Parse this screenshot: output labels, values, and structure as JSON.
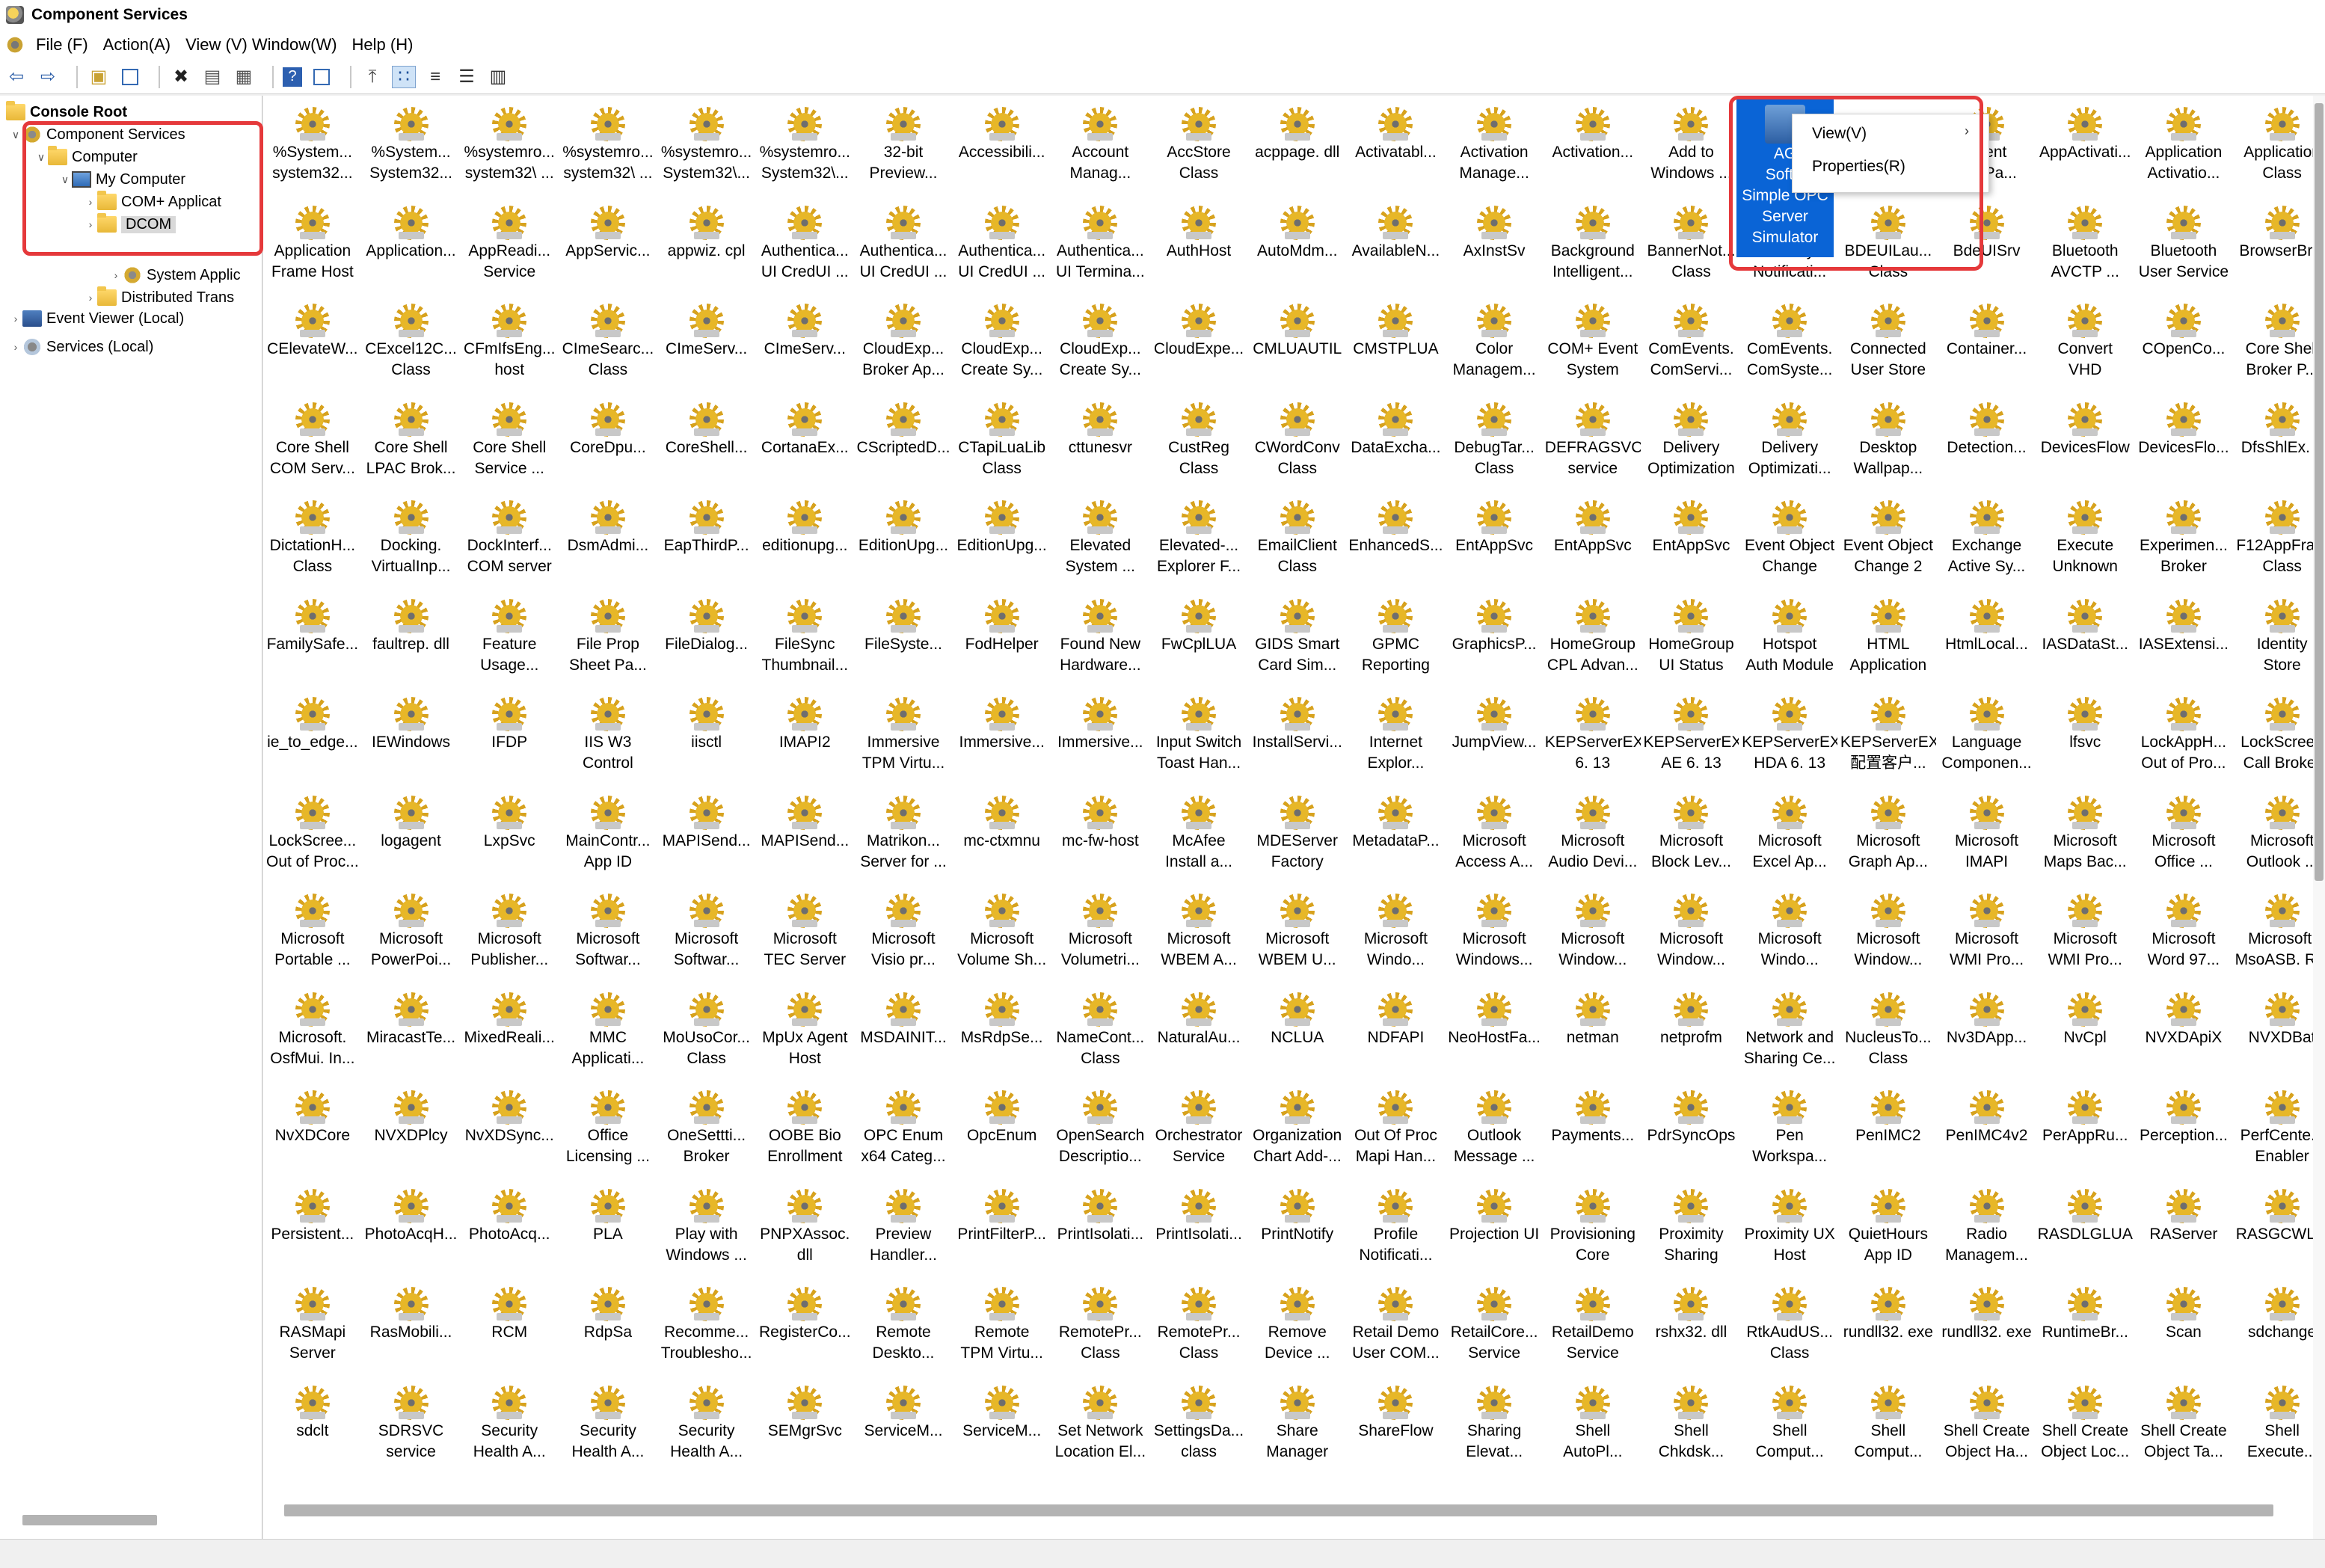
{
  "window": {
    "title": "Component Services"
  },
  "menu": [
    "File (F)",
    "Action(A)",
    "View (V)",
    "Window(W)",
    "Help (H)"
  ],
  "toolbar": [
    "back-icon",
    "forward-icon",
    "up-folder-icon",
    "show-hide-tree-icon",
    "delete-icon",
    "properties-icon",
    "refresh-icon",
    "help-icon",
    "console-icon",
    "export-icon",
    "large-icons-view-icon",
    "small-icons-view-icon",
    "list-view-icon",
    "detail-view-icon"
  ],
  "tree": {
    "console_root": "Console Root",
    "component_services": "Component Services",
    "computer": "Computer",
    "my_computer": "My Computer",
    "complus": "COM+ Applicat",
    "dcom": "DCOM",
    "system_apps": "System Applic",
    "dtc": "Distributed Trans",
    "event_viewer": "Event Viewer (Local)",
    "services": "Services (Local)"
  },
  "context_menu": {
    "view": "View(V)",
    "properties": "Properties(R)"
  },
  "selected_item": [
    "AG",
    "Softw",
    "Simple OPC",
    "Server",
    "Simulator"
  ],
  "items": [
    [
      "%System...",
      "system32..."
    ],
    [
      "%System...",
      "System32..."
    ],
    [
      "%systemro...",
      "system32\\ ..."
    ],
    [
      "%systemro...",
      "system32\\ ..."
    ],
    [
      "%systemro...",
      "System32\\..."
    ],
    [
      "%systemro...",
      "System32\\..."
    ],
    [
      "32-bit",
      "Preview..."
    ],
    [
      "Accessibili...",
      ""
    ],
    [
      "Account",
      "Manag..."
    ],
    [
      "AccStore",
      "Class"
    ],
    [
      "acppage. dll",
      ""
    ],
    [
      "Activatabl...",
      ""
    ],
    [
      "Activation",
      "Manage..."
    ],
    [
      "Activation...",
      ""
    ],
    [
      "Add to",
      "Windows ..."
    ],
    [
      "",
      ""
    ],
    [
      "",
      ""
    ],
    [
      "Client",
      "AppPa..."
    ],
    [
      "AppActivati...",
      ""
    ],
    [
      "Application",
      "Activatio..."
    ],
    [
      "Application",
      "Class"
    ],
    [
      "Application",
      "Frame Host"
    ],
    [
      "Application...",
      ""
    ],
    [
      "AppReadi...",
      "Service"
    ],
    [
      "AppServic...",
      ""
    ],
    [
      "appwiz. cpl",
      ""
    ],
    [
      "Authentica...",
      "UI CredUI ..."
    ],
    [
      "Authentica...",
      "UI CredUI ..."
    ],
    [
      "Authentica...",
      "UI CredUI ..."
    ],
    [
      "Authentica...",
      "UI Termina..."
    ],
    [
      "AuthHost",
      ""
    ],
    [
      "AutoMdm...",
      ""
    ],
    [
      "AvailableN...",
      ""
    ],
    [
      "AxInstSv",
      ""
    ],
    [
      "Background",
      "Intelligent..."
    ],
    [
      "BannerNot...",
      "Class"
    ],
    [
      "Battery",
      "Notificati..."
    ],
    [
      "BDEUILau...",
      "Class"
    ],
    [
      "BdeUISrv",
      ""
    ],
    [
      "Bluetooth",
      "AVCTP ..."
    ],
    [
      "Bluetooth",
      "User Service"
    ],
    [
      "BrowserBr...",
      ""
    ],
    [
      "CElevateW...",
      ""
    ],
    [
      "CExcel12C...",
      "Class"
    ],
    [
      "CFmIfsEng...",
      "host"
    ],
    [
      "CImeSearc...",
      "Class"
    ],
    [
      "CImeServ...",
      ""
    ],
    [
      "CImeServ...",
      ""
    ],
    [
      "CloudExp...",
      "Broker Ap..."
    ],
    [
      "CloudExp...",
      "Create Sy..."
    ],
    [
      "CloudExp...",
      "Create Sy..."
    ],
    [
      "CloudExpe...",
      ""
    ],
    [
      "CMLUAUTIL",
      ""
    ],
    [
      "CMSTPLUA",
      ""
    ],
    [
      "Color",
      "Managem..."
    ],
    [
      "COM+ Event",
      "System"
    ],
    [
      "ComEvents.",
      "ComServi..."
    ],
    [
      "ComEvents.",
      "ComSyste..."
    ],
    [
      "Connected",
      "User Store"
    ],
    [
      "Container...",
      ""
    ],
    [
      "Convert",
      "VHD"
    ],
    [
      "COpenCo...",
      ""
    ],
    [
      "Core Shell",
      "Broker P..."
    ],
    [
      "Core Shell",
      "COM Serv..."
    ],
    [
      "Core Shell",
      "LPAC Brok..."
    ],
    [
      "Core Shell",
      "Service ..."
    ],
    [
      "CoreDpu...",
      ""
    ],
    [
      "CoreShell...",
      ""
    ],
    [
      "CortanaEx...",
      ""
    ],
    [
      "CScriptedD...",
      ""
    ],
    [
      "CTapiLuaLib",
      "Class"
    ],
    [
      "cttunesvr",
      ""
    ],
    [
      "CustReg",
      "Class"
    ],
    [
      "CWordConv",
      "Class"
    ],
    [
      "DataExcha...",
      ""
    ],
    [
      "DebugTar...",
      "Class"
    ],
    [
      "DEFRAGSVC",
      "service"
    ],
    [
      "Delivery",
      "Optimization"
    ],
    [
      "Delivery",
      "Optimizati..."
    ],
    [
      "Desktop",
      "Wallpap..."
    ],
    [
      "Detection...",
      ""
    ],
    [
      "DevicesFlow",
      ""
    ],
    [
      "DevicesFlo...",
      ""
    ],
    [
      "DfsShlEx. d",
      ""
    ],
    [
      "DictationH...",
      "Class"
    ],
    [
      "Docking.",
      "VirtualInp..."
    ],
    [
      "DockInterf...",
      "COM server"
    ],
    [
      "DsmAdmi...",
      ""
    ],
    [
      "EapThirdP...",
      ""
    ],
    [
      "editionupg...",
      ""
    ],
    [
      "EditionUpg...",
      ""
    ],
    [
      "EditionUpg...",
      ""
    ],
    [
      "Elevated",
      "System ..."
    ],
    [
      "Elevated-...",
      "Explorer F..."
    ],
    [
      "EmailClient",
      "Class"
    ],
    [
      "EnhancedS...",
      ""
    ],
    [
      "EntAppSvc",
      ""
    ],
    [
      "EntAppSvc",
      ""
    ],
    [
      "EntAppSvc",
      ""
    ],
    [
      "Event Object",
      "Change"
    ],
    [
      "Event Object",
      "Change 2"
    ],
    [
      "Exchange",
      "Active Sy..."
    ],
    [
      "Execute",
      "Unknown"
    ],
    [
      "Experimen...",
      "Broker"
    ],
    [
      "F12AppFra...",
      "Class"
    ],
    [
      "FamilySafe...",
      ""
    ],
    [
      "faultrep. dll",
      ""
    ],
    [
      "Feature",
      "Usage..."
    ],
    [
      "File Prop",
      "Sheet Pa..."
    ],
    [
      "FileDialog...",
      ""
    ],
    [
      "FileSync",
      "Thumbnail..."
    ],
    [
      "FileSyste...",
      ""
    ],
    [
      "FodHelper",
      ""
    ],
    [
      "Found New",
      "Hardware..."
    ],
    [
      "FwCplLUA",
      ""
    ],
    [
      "GIDS Smart",
      "Card Sim..."
    ],
    [
      "GPMC",
      "Reporting"
    ],
    [
      "GraphicsP...",
      ""
    ],
    [
      "HomeGroup",
      "CPL Advan..."
    ],
    [
      "HomeGroup",
      "UI Status"
    ],
    [
      "Hotspot",
      "Auth Module"
    ],
    [
      "HTML",
      "Application"
    ],
    [
      "HtmlLocal...",
      ""
    ],
    [
      "IASDataSt...",
      ""
    ],
    [
      "IASExtensi...",
      ""
    ],
    [
      "Identity",
      "Store"
    ],
    [
      "ie_to_edge...",
      ""
    ],
    [
      "IEWindows",
      ""
    ],
    [
      "IFDP",
      ""
    ],
    [
      "IIS W3",
      "Control"
    ],
    [
      "iisctl",
      ""
    ],
    [
      "IMAPI2",
      ""
    ],
    [
      "Immersive",
      "TPM Virtu..."
    ],
    [
      "Immersive...",
      ""
    ],
    [
      "Immersive...",
      ""
    ],
    [
      "Input Switch",
      "Toast Han..."
    ],
    [
      "InstallServi...",
      ""
    ],
    [
      "Internet",
      "Explor..."
    ],
    [
      "JumpView...",
      ""
    ],
    [
      "KEPServerEX",
      "6. 13"
    ],
    [
      "KEPServerEX",
      "AE 6. 13"
    ],
    [
      "KEPServerEX",
      "HDA 6. 13"
    ],
    [
      "KEPServerEX",
      "配置客户..."
    ],
    [
      "Language",
      "Componen..."
    ],
    [
      "lfsvc",
      ""
    ],
    [
      "LockAppH...",
      "Out of Pro..."
    ],
    [
      "LockScreen",
      "Call Broker"
    ],
    [
      "LockScree...",
      "Out of Proc..."
    ],
    [
      "logagent",
      ""
    ],
    [
      "LxpSvc",
      ""
    ],
    [
      "MainContr...",
      "App ID"
    ],
    [
      "MAPISend...",
      ""
    ],
    [
      "MAPISend...",
      ""
    ],
    [
      "Matrikon...",
      "Server for ..."
    ],
    [
      "mc-ctxmnu",
      ""
    ],
    [
      "mc-fw-host",
      ""
    ],
    [
      "McAfee",
      "Install a..."
    ],
    [
      "MDEServer",
      "Factory"
    ],
    [
      "MetadataP...",
      ""
    ],
    [
      "Microsoft",
      "Access A..."
    ],
    [
      "Microsoft",
      "Audio Devi..."
    ],
    [
      "Microsoft",
      "Block Lev..."
    ],
    [
      "Microsoft",
      "Excel Ap..."
    ],
    [
      "Microsoft",
      "Graph Ap..."
    ],
    [
      "Microsoft",
      "IMAPI"
    ],
    [
      "Microsoft",
      "Maps Bac..."
    ],
    [
      "Microsoft",
      "Office ..."
    ],
    [
      "Microsoft",
      "Outlook ..."
    ],
    [
      "Microsoft",
      "Portable ..."
    ],
    [
      "Microsoft",
      "PowerPoi..."
    ],
    [
      "Microsoft",
      "Publisher..."
    ],
    [
      "Microsoft",
      "Softwar..."
    ],
    [
      "Microsoft",
      "Softwar..."
    ],
    [
      "Microsoft",
      "TEC Server"
    ],
    [
      "Microsoft",
      "Visio pr..."
    ],
    [
      "Microsoft",
      "Volume Sh..."
    ],
    [
      "Microsoft",
      "Volumetri..."
    ],
    [
      "Microsoft",
      "WBEM A..."
    ],
    [
      "Microsoft",
      "WBEM U..."
    ],
    [
      "Microsoft",
      "Windo..."
    ],
    [
      "Microsoft",
      "Windows..."
    ],
    [
      "Microsoft",
      "Window..."
    ],
    [
      "Microsoft",
      "Window..."
    ],
    [
      "Microsoft",
      "Windo..."
    ],
    [
      "Microsoft",
      "Window..."
    ],
    [
      "Microsoft",
      "WMI Pro..."
    ],
    [
      "Microsoft",
      "WMI Pro..."
    ],
    [
      "Microsoft",
      "Word 97..."
    ],
    [
      "Microsoft.",
      "MsoASB. R..."
    ],
    [
      "Microsoft.",
      "OsfMui. In..."
    ],
    [
      "MiracastTe...",
      ""
    ],
    [
      "MixedReali...",
      ""
    ],
    [
      "MMC",
      "Applicati..."
    ],
    [
      "MoUsoCor...",
      "Class"
    ],
    [
      "MpUx Agent",
      "Host"
    ],
    [
      "MSDAINIT...",
      ""
    ],
    [
      "MsRdpSe...",
      ""
    ],
    [
      "NameCont...",
      "Class"
    ],
    [
      "NaturalAu...",
      ""
    ],
    [
      "NCLUA",
      ""
    ],
    [
      "NDFAPI",
      ""
    ],
    [
      "NeoHostFa...",
      ""
    ],
    [
      "netman",
      ""
    ],
    [
      "netprofm",
      ""
    ],
    [
      "Network and",
      "Sharing Ce..."
    ],
    [
      "NucleusTo...",
      "Class"
    ],
    [
      "Nv3DApp...",
      ""
    ],
    [
      "NvCpl",
      ""
    ],
    [
      "NVXDApiX",
      ""
    ],
    [
      "NVXDBat",
      ""
    ],
    [
      "NvXDCore",
      ""
    ],
    [
      "NVXDPlcy",
      ""
    ],
    [
      "NvXDSync...",
      ""
    ],
    [
      "Office",
      "Licensing ..."
    ],
    [
      "OneSettti...",
      "Broker"
    ],
    [
      "OOBE Bio",
      "Enrollment"
    ],
    [
      "OPC Enum",
      "x64 Categ..."
    ],
    [
      "OpcEnum",
      ""
    ],
    [
      "OpenSearch",
      "Descriptio..."
    ],
    [
      "Orchestrator",
      "Service"
    ],
    [
      "Organization",
      "Chart Add-..."
    ],
    [
      "Out Of Proc",
      "Mapi Han..."
    ],
    [
      "Outlook",
      "Message ..."
    ],
    [
      "Payments...",
      ""
    ],
    [
      "PdrSyncOps",
      ""
    ],
    [
      "Pen",
      "Workspa..."
    ],
    [
      "PenIMC2",
      ""
    ],
    [
      "PenIMC4v2",
      ""
    ],
    [
      "PerAppRu...",
      ""
    ],
    [
      "Perception...",
      ""
    ],
    [
      "PerfCente...",
      "Enabler"
    ],
    [
      "Persistent...",
      ""
    ],
    [
      "PhotoAcqH...",
      ""
    ],
    [
      "PhotoAcq...",
      ""
    ],
    [
      "PLA",
      ""
    ],
    [
      "Play with",
      "Windows ..."
    ],
    [
      "PNPXAssoc.",
      "dll"
    ],
    [
      "Preview",
      "Handler..."
    ],
    [
      "PrintFilterP...",
      ""
    ],
    [
      "PrintIsolati...",
      ""
    ],
    [
      "PrintIsolati...",
      ""
    ],
    [
      "PrintNotify",
      ""
    ],
    [
      "Profile",
      "Notificati..."
    ],
    [
      "Projection UI",
      ""
    ],
    [
      "Provisioning",
      "Core"
    ],
    [
      "Proximity",
      "Sharing"
    ],
    [
      "Proximity UX",
      "Host"
    ],
    [
      "QuietHours",
      "App ID"
    ],
    [
      "Radio",
      "Managem..."
    ],
    [
      "RASDLGLUA",
      ""
    ],
    [
      "RAServer",
      ""
    ],
    [
      "RASGCWL...",
      ""
    ],
    [
      "RASMapi",
      "Server"
    ],
    [
      "RasMobili...",
      ""
    ],
    [
      "RCM",
      ""
    ],
    [
      "RdpSa",
      ""
    ],
    [
      "Recomme...",
      "Troublesho..."
    ],
    [
      "RegisterCo...",
      ""
    ],
    [
      "Remote",
      "Deskto..."
    ],
    [
      "Remote",
      "TPM Virtu..."
    ],
    [
      "RemotePr...",
      "Class"
    ],
    [
      "RemotePr...",
      "Class"
    ],
    [
      "Remove",
      "Device ..."
    ],
    [
      "Retail Demo",
      "User COM..."
    ],
    [
      "RetailCore...",
      "Service"
    ],
    [
      "RetailDemo",
      "Service"
    ],
    [
      "rshx32. dll",
      ""
    ],
    [
      "RtkAudUS...",
      "Class"
    ],
    [
      "rundll32. exe",
      ""
    ],
    [
      "rundll32. exe",
      ""
    ],
    [
      "RuntimeBr...",
      ""
    ],
    [
      "Scan",
      ""
    ],
    [
      "sdchange",
      ""
    ],
    [
      "sdclt",
      ""
    ],
    [
      "SDRSVC",
      "service"
    ],
    [
      "Security",
      "Health A..."
    ],
    [
      "Security",
      "Health A..."
    ],
    [
      "Security",
      "Health A..."
    ],
    [
      "SEMgrSvc",
      ""
    ],
    [
      "ServiceM...",
      ""
    ],
    [
      "ServiceM...",
      ""
    ],
    [
      "Set Network",
      "Location El..."
    ],
    [
      "SettingsDa...",
      "class"
    ],
    [
      "Share",
      "Manager"
    ],
    [
      "ShareFlow",
      ""
    ],
    [
      "Sharing",
      "Elevat..."
    ],
    [
      "Shell",
      "AutoPl..."
    ],
    [
      "Shell",
      "Chkdsk..."
    ],
    [
      "Shell",
      "Comput..."
    ],
    [
      "Shell",
      "Comput..."
    ],
    [
      "Shell Create",
      "Object Ha..."
    ],
    [
      "Shell Create",
      "Object Loc..."
    ],
    [
      "Shell Create",
      "Object Ta..."
    ],
    [
      "Shell",
      "Execute..."
    ]
  ]
}
